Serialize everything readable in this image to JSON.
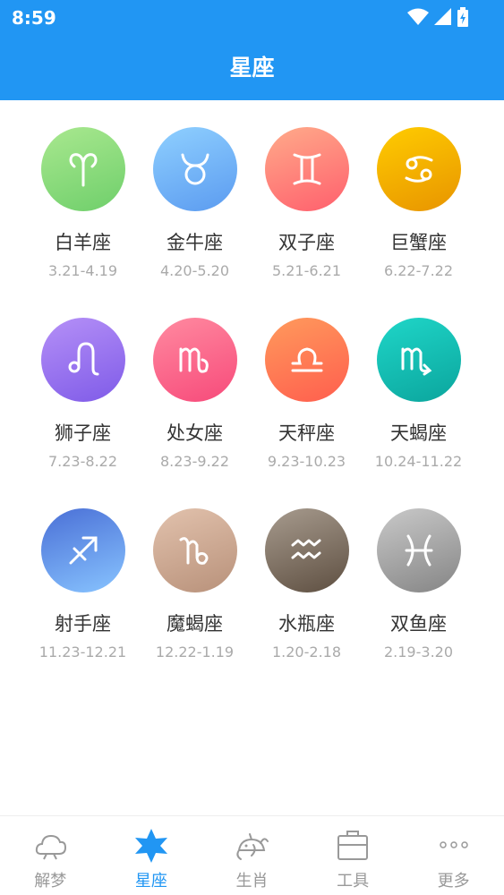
{
  "status": {
    "time": "8:59"
  },
  "header": {
    "title": "星座"
  },
  "signs": [
    {
      "name": "白羊座",
      "date": "3.21-4.19",
      "icon": "aries-icon",
      "colors": [
        "#a9e88f",
        "#6fcf6b"
      ]
    },
    {
      "name": "金牛座",
      "date": "4.20-5.20",
      "icon": "taurus-icon",
      "colors": [
        "#8fd0ff",
        "#5b9bf0"
      ]
    },
    {
      "name": "双子座",
      "date": "5.21-6.21",
      "icon": "gemini-icon",
      "colors": [
        "#ffab8a",
        "#ff5f6d"
      ]
    },
    {
      "name": "巨蟹座",
      "date": "6.22-7.22",
      "icon": "cancer-icon",
      "colors": [
        "#ffcc00",
        "#e89400"
      ]
    },
    {
      "name": "狮子座",
      "date": "7.23-8.22",
      "icon": "leo-icon",
      "colors": [
        "#b590f7",
        "#7f5be8"
      ]
    },
    {
      "name": "处女座",
      "date": "8.23-9.22",
      "icon": "virgo-icon",
      "colors": [
        "#ff8aa0",
        "#f74a7a"
      ]
    },
    {
      "name": "天秤座",
      "date": "9.23-10.23",
      "icon": "libra-icon",
      "colors": [
        "#ff9a5c",
        "#ff5e4e"
      ]
    },
    {
      "name": "天蝎座",
      "date": "10.24-11.22",
      "icon": "scorpio-icon",
      "colors": [
        "#1fd6c8",
        "#0ba59d"
      ]
    },
    {
      "name": "射手座",
      "date": "11.23-12.21",
      "icon": "sagittarius-icon",
      "colors": [
        "#4a6fd6",
        "#88c4ff"
      ]
    },
    {
      "name": "魔蝎座",
      "date": "12.22-1.19",
      "icon": "capricorn-icon",
      "colors": [
        "#e2c2ad",
        "#b8917a"
      ]
    },
    {
      "name": "水瓶座",
      "date": "1.20-2.18",
      "icon": "aquarius-icon",
      "colors": [
        "#a79b8e",
        "#5e4f41"
      ]
    },
    {
      "name": "双鱼座",
      "date": "2.19-3.20",
      "icon": "pisces-icon",
      "colors": [
        "#c9c9c9",
        "#858585"
      ]
    }
  ],
  "tabs": [
    {
      "label": "解梦",
      "icon": "cloud-icon",
      "active": false
    },
    {
      "label": "星座",
      "icon": "star-icon",
      "active": true
    },
    {
      "label": "生肖",
      "icon": "mouse-icon",
      "active": false
    },
    {
      "label": "工具",
      "icon": "toolbox-icon",
      "active": false
    },
    {
      "label": "更多",
      "icon": "more-dots-icon",
      "active": false
    }
  ]
}
